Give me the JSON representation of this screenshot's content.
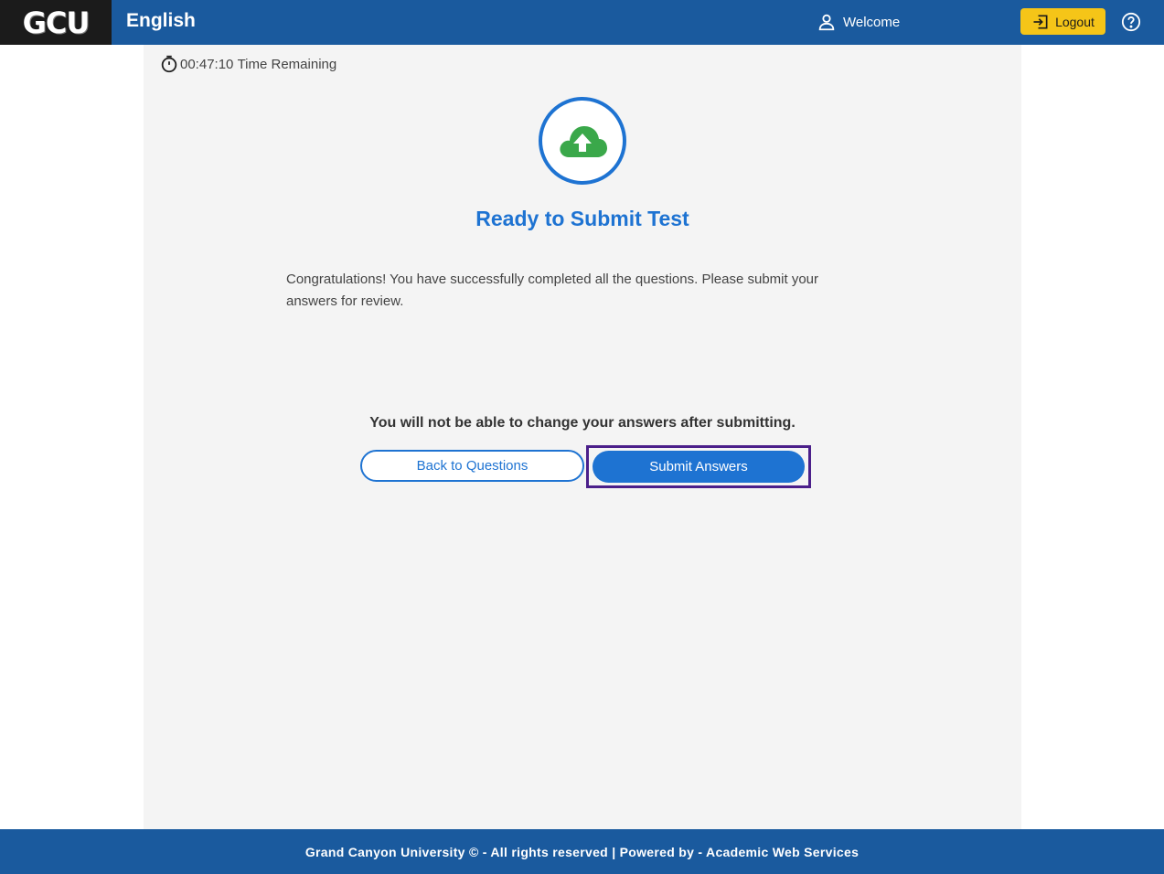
{
  "header": {
    "logo_text": "GCU",
    "title": "English",
    "welcome_label": "Welcome",
    "logout_label": "Logout",
    "icons": [
      "user-icon",
      "logout-icon",
      "help-icon"
    ]
  },
  "timer": {
    "time": "00:47:10",
    "label": "Time Remaining",
    "icon": "stopwatch-icon"
  },
  "submit_panel": {
    "icon": "cloud-upload-icon",
    "title": "Ready to Submit Test",
    "message": "Congratulations! You have successfully completed all the questions. Please submit your answers for review.",
    "warning": "You will not be able to change your answers after submitting.",
    "back_label": "Back to Questions",
    "submit_label": "Submit Answers"
  },
  "footer": {
    "text": "Grand Canyon University © - All rights reserved | Powered by - Academic Web Services"
  },
  "colors": {
    "header_bg": "#1a5a9e",
    "accent": "#1e73d2",
    "logout_bg": "#f5c518",
    "cloud": "#3aa84a",
    "highlight_frame": "#4b1f8a"
  }
}
